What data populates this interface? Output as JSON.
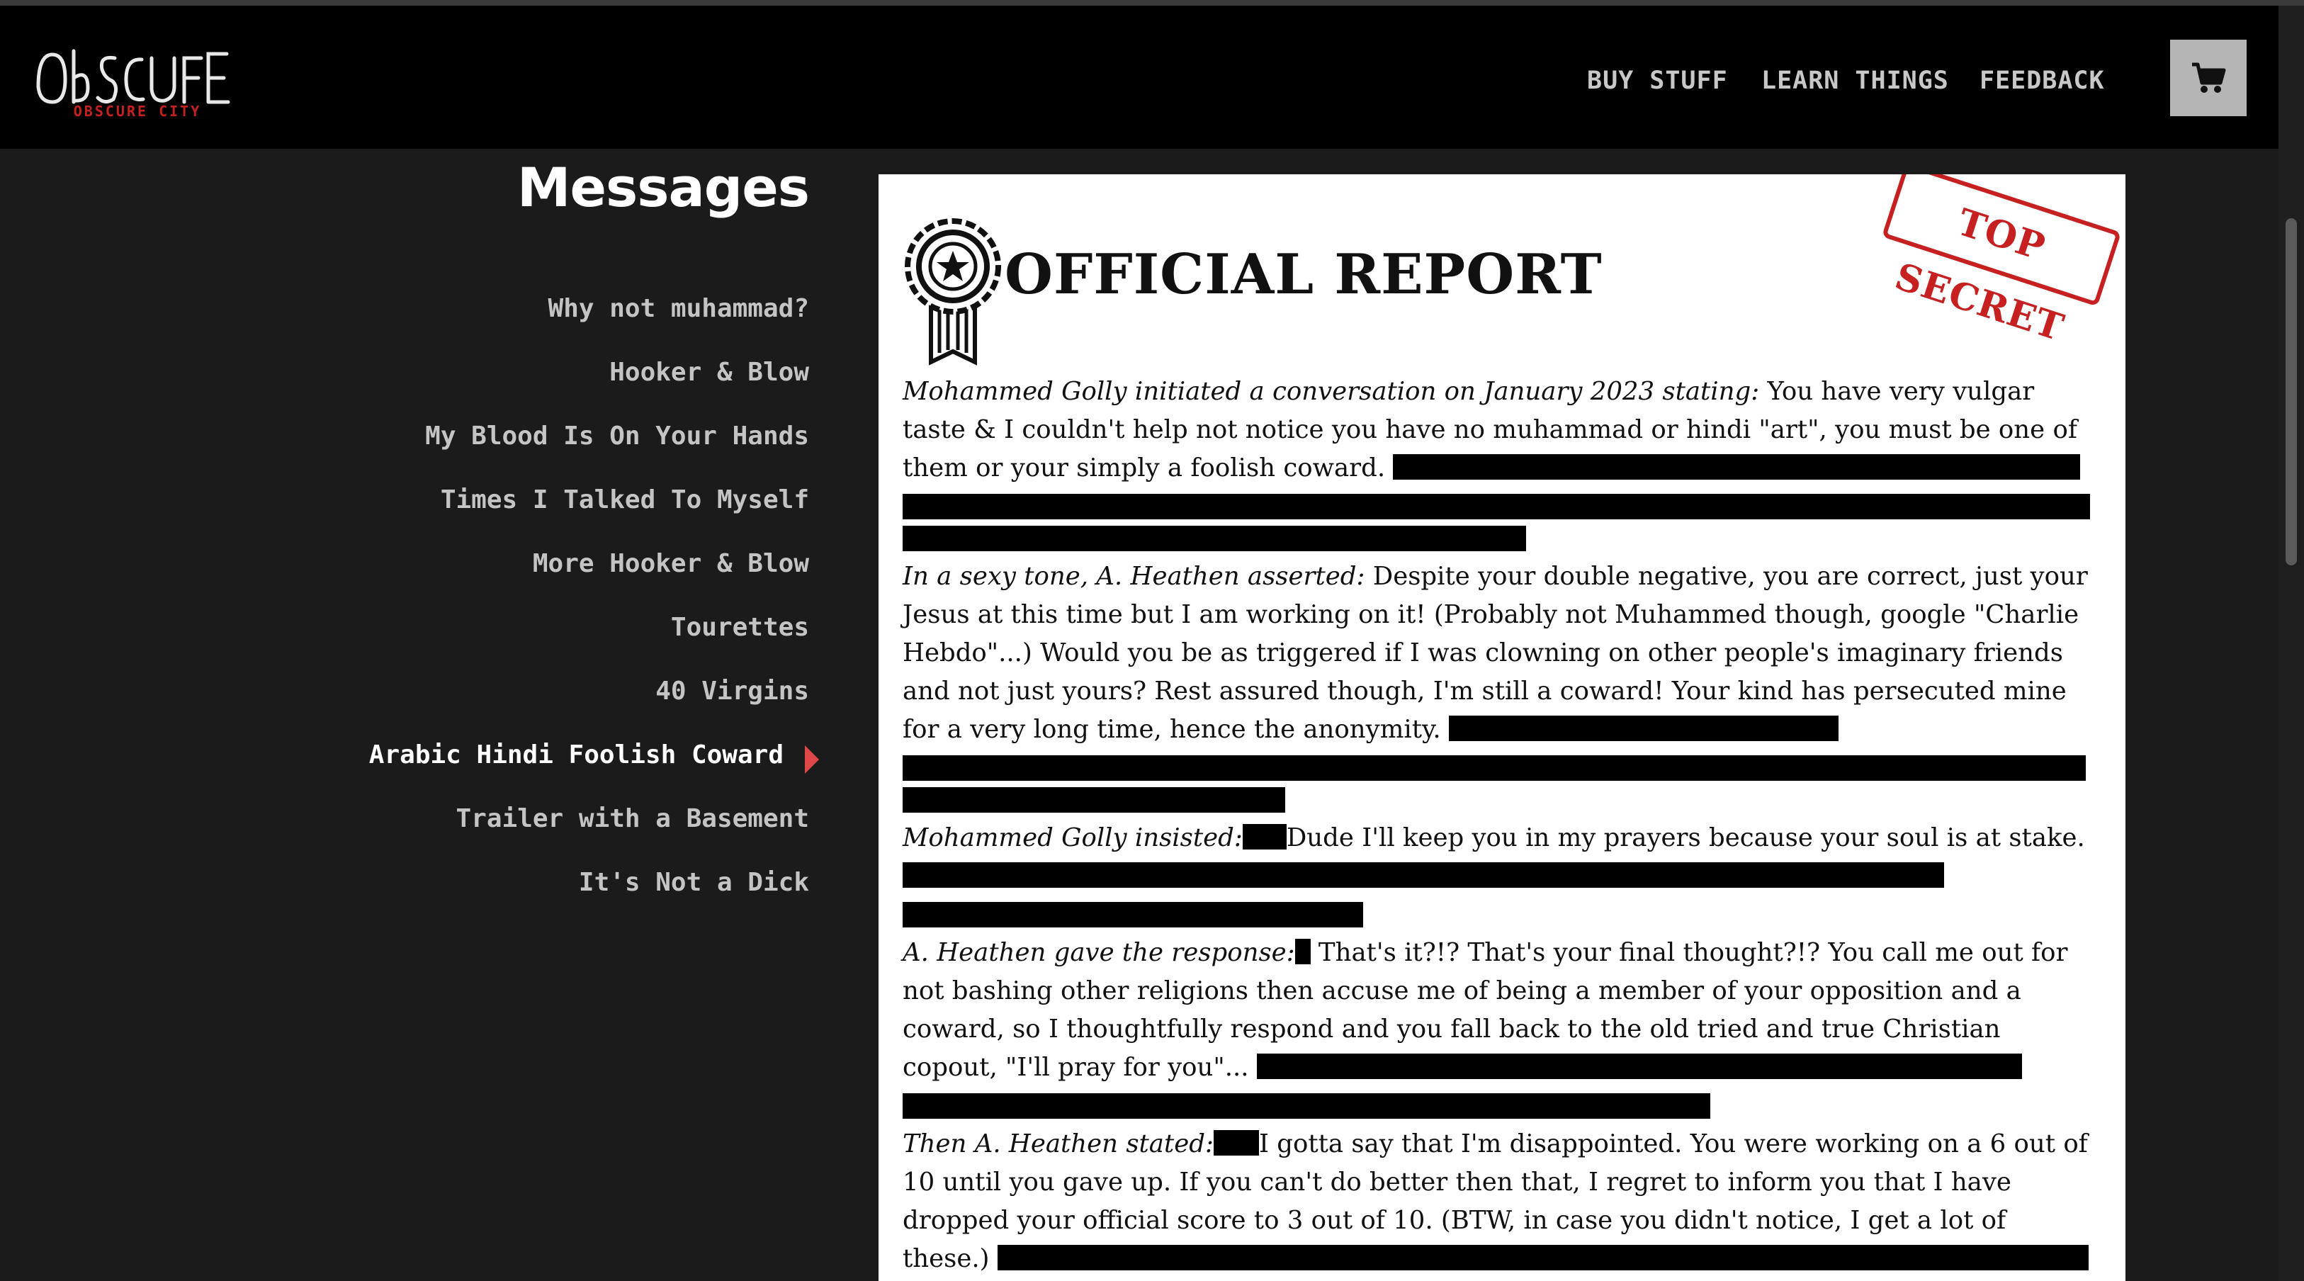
{
  "header": {
    "logo_text": "OBSCURE CITY",
    "nav": {
      "buy": "BUY STUFF",
      "learn": "LEARN THINGS",
      "feedback": "FEEDBACK"
    },
    "cart_icon": "shopping-cart-icon"
  },
  "sidebar": {
    "title": "Messages",
    "items": [
      {
        "label": "Why not muhammad?"
      },
      {
        "label": "Hooker & Blow"
      },
      {
        "label": "My Blood Is On Your Hands"
      },
      {
        "label": "Times I Talked To Myself"
      },
      {
        "label": "More Hooker & Blow"
      },
      {
        "label": "Tourettes"
      },
      {
        "label": "40 Virgins"
      },
      {
        "label": "Arabic Hindi Foolish Coward",
        "active": true
      },
      {
        "label": "Trailer with a Basement"
      },
      {
        "label": "It's Not a Dick"
      }
    ]
  },
  "report": {
    "title": "OFFICIAL REPORT",
    "stamp": "TOP SECRET",
    "badge_icon": "star-ribbon-badge-icon",
    "paragraphs": [
      {
        "speaker": "Mohammed Golly initiated a conversation on January 2023 stating:",
        "text": " You have very vulgar taste & I couldn't help not notice you have no muhammad or hindi \"art\", you must be one of them or your simply a foolish coward. "
      },
      {
        "speaker": "In a sexy tone, A. Heathen asserted:",
        "text": " Despite your double negative, you are correct, just your Jesus at this time but I am working on it! (Probably not Muhammed though, google \"Charlie Hebdo\"...) Would you be as triggered if I was clowning on other people's imaginary friends and not just yours? Rest assured though, I'm still a coward! Your kind has persecuted mine for a very long time, hence the anonymity. "
      },
      {
        "speaker": "Mohammed Golly insisted:",
        "text": "Dude I'll keep you in my prayers because your soul is at stake. "
      },
      {
        "speaker": "A. Heathen gave the response:",
        "text": " That's it?!? That's your final thought?!? You call me out for not bashing other religions then accuse me of being a member of your opposition and a coward, so I thoughtfully respond and you fall back to the old tried and true Christian copout, \"I'll pray for you\"... "
      },
      {
        "speaker": "Then A. Heathen stated:",
        "text": "I gotta say that I'm disappointed. You were working on a 6 out of 10 until you gave up. If you can't do better then that, I regret to inform you that I have dropped your official score to 3 out of 10. (BTW, in case you didn't notice, I get a lot of these.) "
      }
    ]
  },
  "colors": {
    "header_bg": "#000000",
    "page_bg": "#1b1b1b",
    "active_arrow": "#e04848",
    "stamp_red": "#c62020"
  }
}
